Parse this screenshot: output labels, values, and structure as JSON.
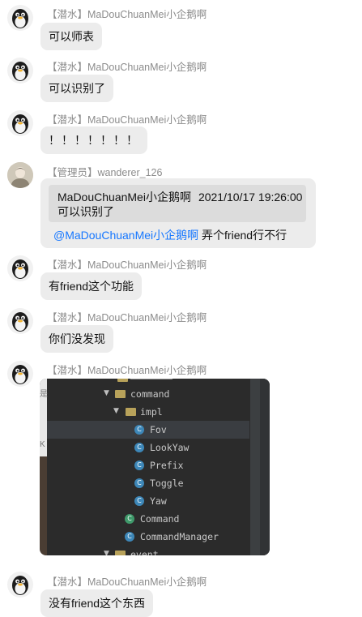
{
  "messages": [
    {
      "sender": "【潜水】MaDouChuanMei小企鹅啊",
      "text": "可以师表"
    },
    {
      "sender": "【潜水】MaDouChuanMei小企鹅啊",
      "text": "可以识别了"
    },
    {
      "sender": "【潜水】MaDouChuanMei小企鹅啊",
      "text": "！！！！！！！"
    },
    {
      "sender": "【管理员】wanderer_126",
      "quote_author": "MaDouChuanMei小企鹅啊",
      "quote_time": "2021/10/17 19:26:00",
      "quote_text": "可以识别了",
      "mention": "@MaDouChuanMei小企鹅啊",
      "text": " 弄个friend行不行"
    },
    {
      "sender": "【潜水】MaDouChuanMei小企鹅啊",
      "text": "有friend这个功能"
    },
    {
      "sender": "【潜水】MaDouChuanMei小企鹅啊",
      "text": "你们没发现"
    },
    {
      "sender": "【潜水】MaDouChuanMei小企鹅啊"
    },
    {
      "sender": "【潜水】MaDouChuanMei小企鹅啊",
      "text": "没有friend这个东西"
    }
  ],
  "screenshot_tree": {
    "items": [
      "command",
      "impl",
      "Fov",
      "LookYaw",
      "Prefix",
      "Toggle",
      "Yaw",
      "Command",
      "CommandManager",
      "event"
    ],
    "side_chars": [
      "是",
      "K"
    ]
  }
}
